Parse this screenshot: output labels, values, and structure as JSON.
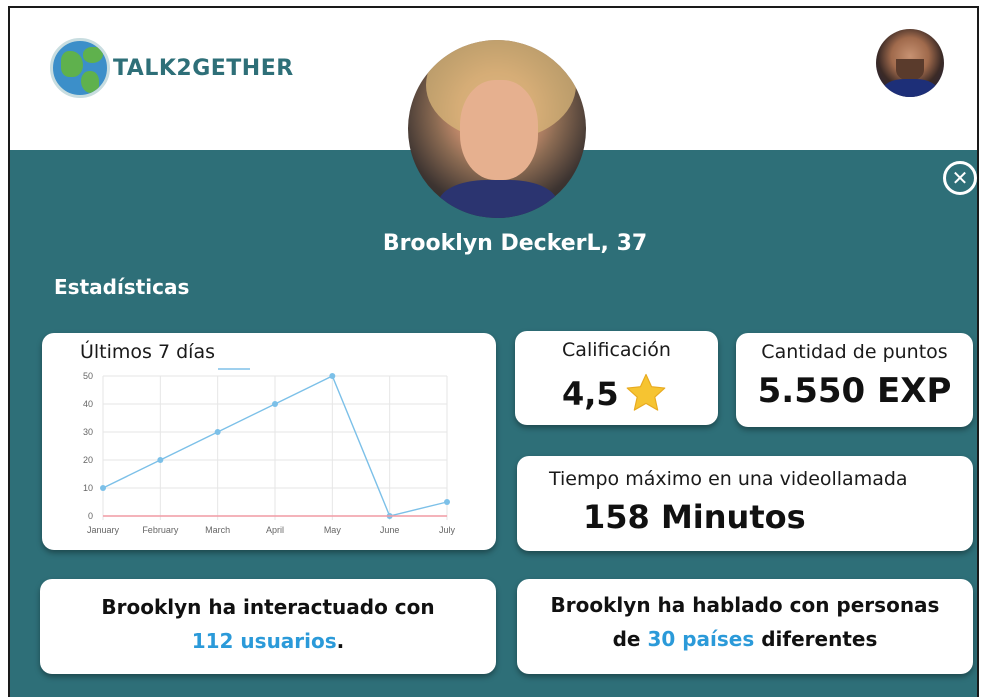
{
  "app": {
    "logo_text": "TALK2GETHER"
  },
  "profile": {
    "name": "Brooklyn DeckerL, 37"
  },
  "section": {
    "title": "Estadísticas"
  },
  "chart_card": {
    "title": "Últimos 7 días"
  },
  "chart_data": {
    "type": "line",
    "categories": [
      "January",
      "February",
      "March",
      "April",
      "May",
      "June",
      "July"
    ],
    "series": [
      {
        "values": [
          10,
          20,
          30,
          40,
          50,
          0,
          5
        ],
        "color": "#7cc0e8"
      },
      {
        "values": [
          0,
          0,
          0,
          0,
          0,
          0,
          0
        ],
        "color": "#f19aa4"
      }
    ],
    "ylim": [
      0,
      50
    ],
    "yticks": [
      0,
      10,
      20,
      30,
      40,
      50
    ],
    "grid": true,
    "title": "",
    "xlabel": "",
    "ylabel": ""
  },
  "rating": {
    "label": "Calificación",
    "value": "4,5",
    "icon": "star-icon"
  },
  "points": {
    "label": "Cantidad de puntos",
    "value": "5.550 EXP"
  },
  "time": {
    "label": "Tiempo máximo en una videollamada",
    "value": "158 Minutos"
  },
  "interactions": {
    "line1": "Brooklyn ha interactuado con",
    "highlight": "112 usuarios",
    "suffix": "."
  },
  "countries": {
    "line1": "Brooklyn ha hablado con personas",
    "prefix": "de ",
    "highlight": "30 países",
    "suffix": " diferentes"
  },
  "colors": {
    "panel": "#2e6f78",
    "accent": "#2b9ad9",
    "star": "#f6c431"
  }
}
